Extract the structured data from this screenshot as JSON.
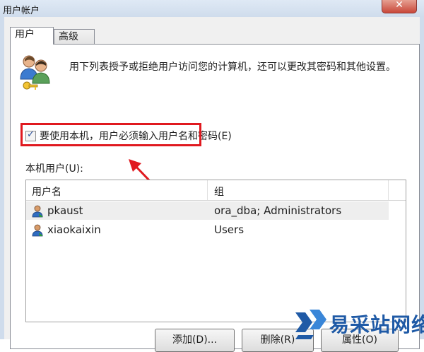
{
  "window": {
    "title": "用户帐户",
    "close_glyph": "✕"
  },
  "tabs": [
    {
      "label": "用户",
      "active": true
    },
    {
      "label": "高级",
      "active": false
    }
  ],
  "description": "用下列表授予或拒绝用户访问您的计算机，还可以更改其密码和其他设置。",
  "checkbox": {
    "label": "要使用本机，用户必须输入用户名和密码(E)",
    "checked": true
  },
  "list": {
    "caption": "本机用户(U):",
    "columns": [
      "用户名",
      "组"
    ],
    "rows": [
      {
        "name": "pkaust",
        "group": "ora_dba; Administrators",
        "selected": true
      },
      {
        "name": "xiaokaixin",
        "group": "Users",
        "selected": false
      }
    ]
  },
  "buttons": {
    "add": "添加(D)...",
    "remove": "删除(R)",
    "properties": "属性(O)"
  },
  "watermark": {
    "text": "易采站网络"
  },
  "colors": {
    "highlight": "#e0191f",
    "watermark": "#1f5aa6",
    "checkmark": "#2a4f9a"
  },
  "icons": {
    "users": "users-icon",
    "user_row": "user-icon",
    "arrow": "red-arrow-annotation"
  }
}
